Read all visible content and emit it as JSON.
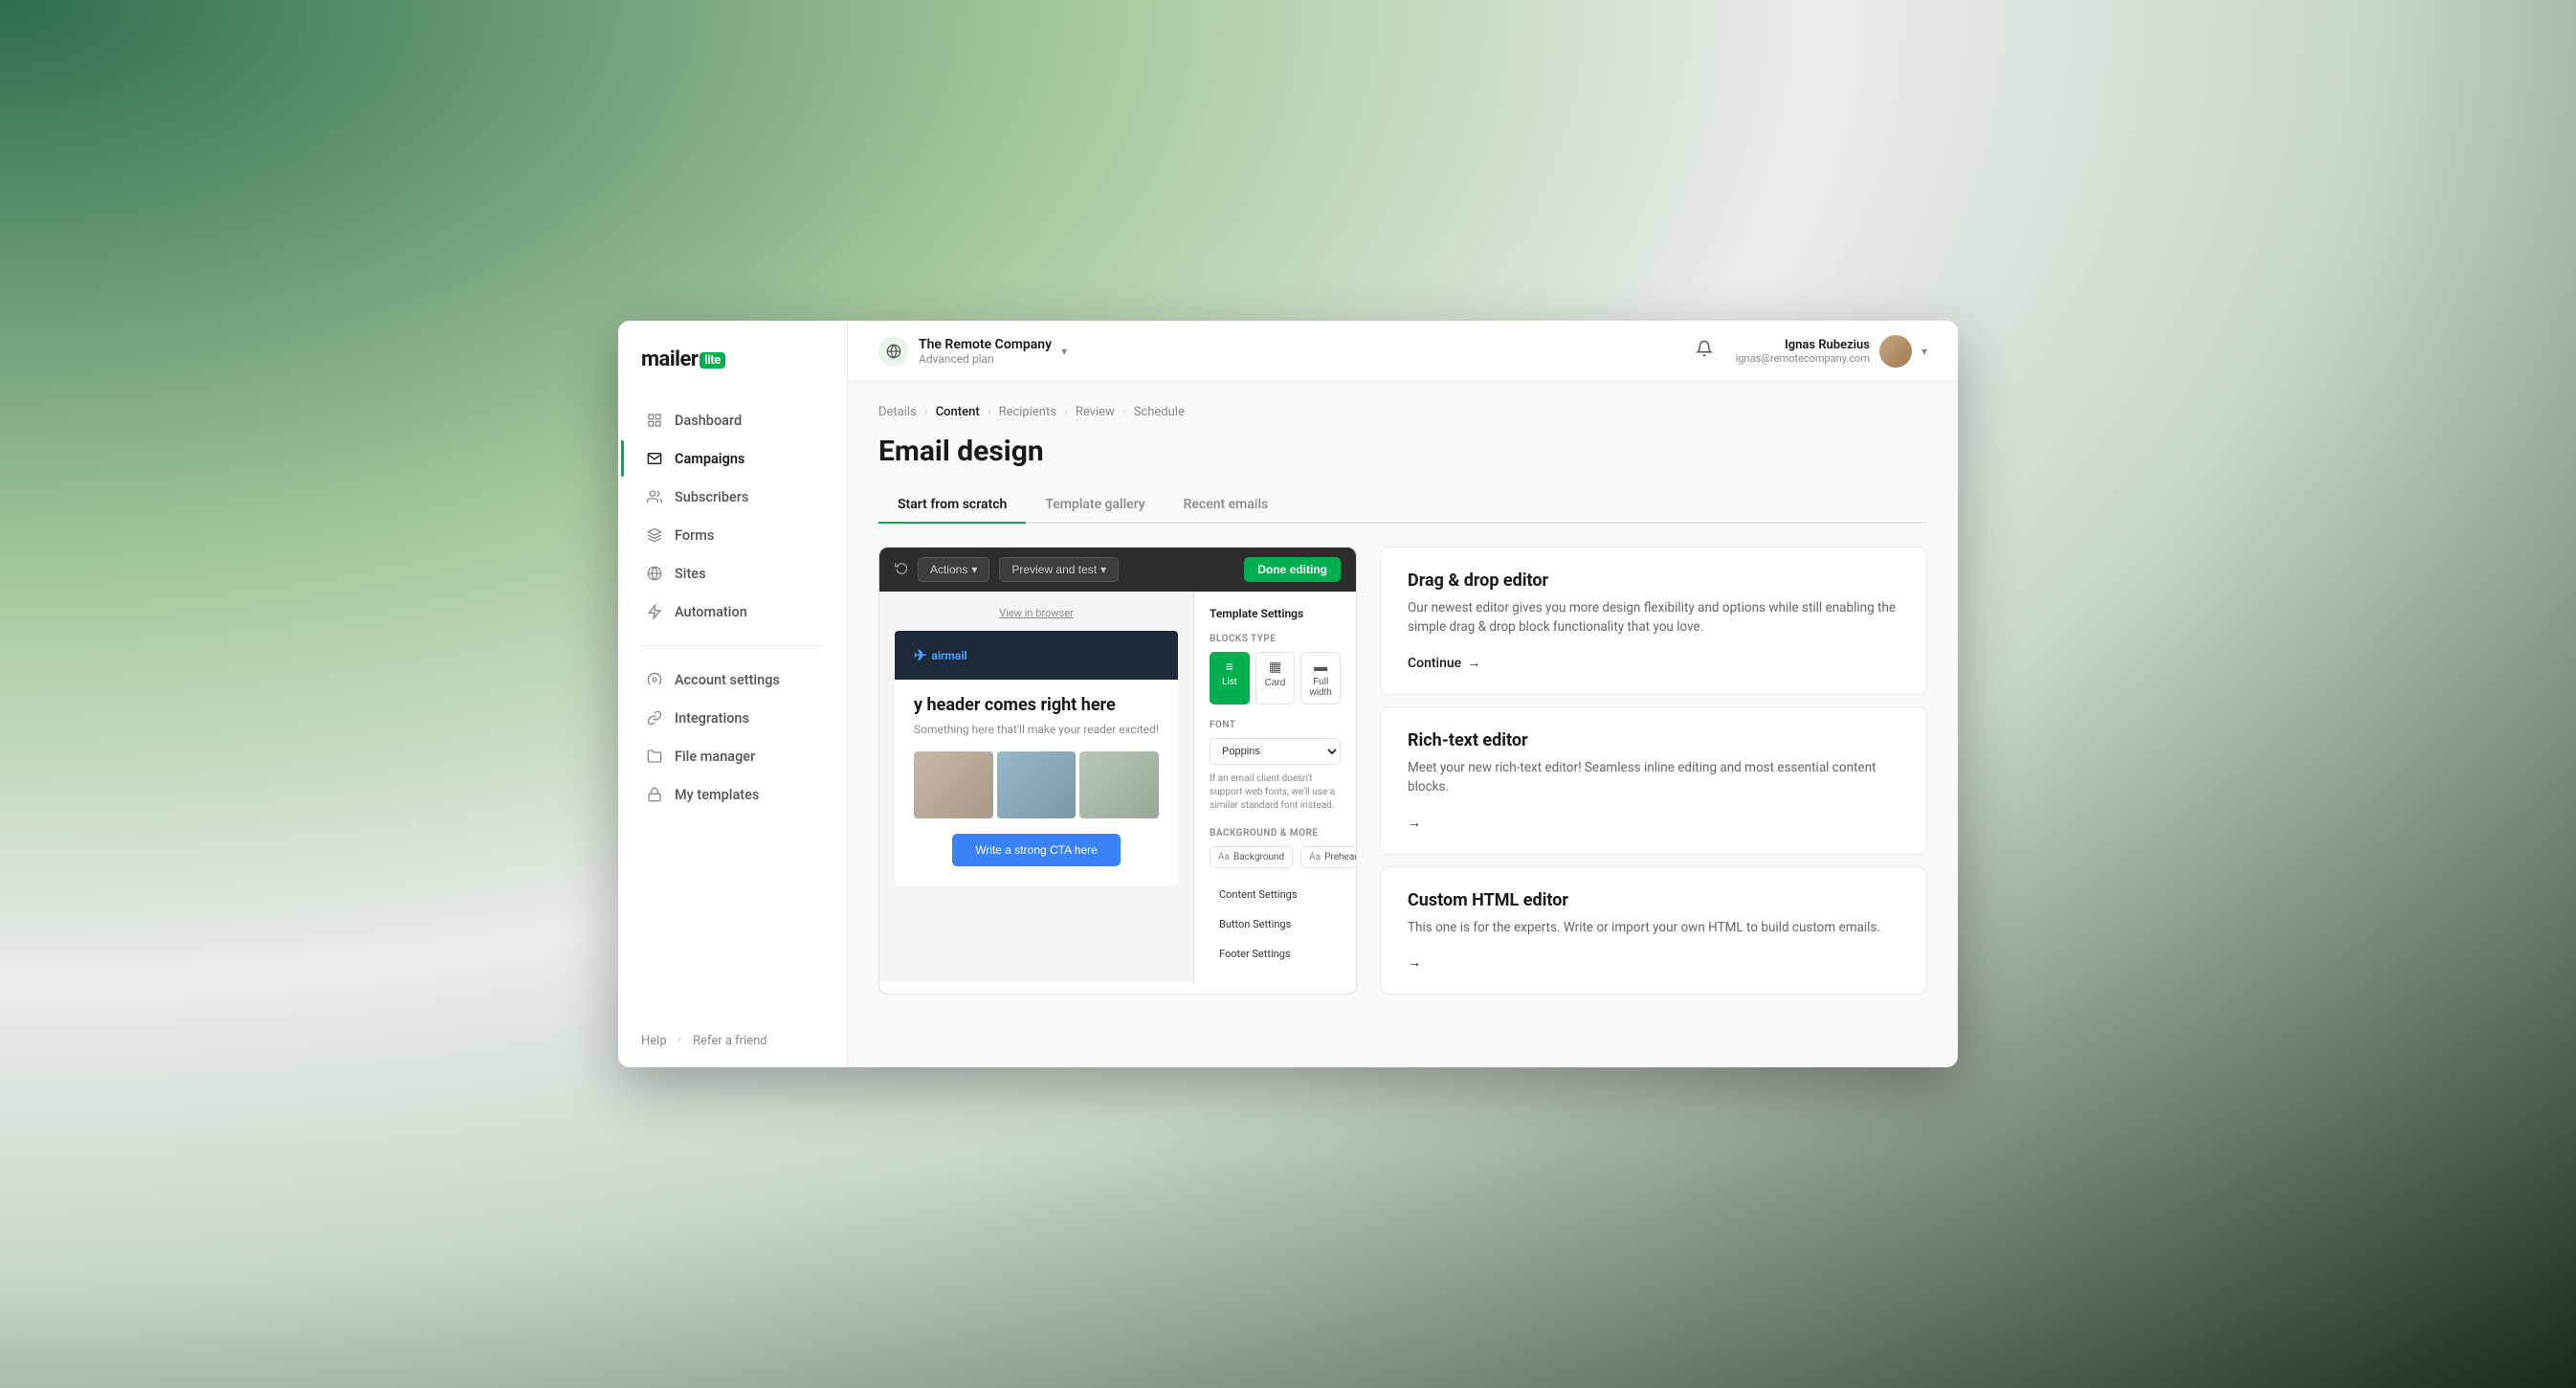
{
  "app": {
    "logo_main": "mailer",
    "logo_badge": "lite"
  },
  "header": {
    "company_name": "The Remote Company",
    "company_plan": "Advanced plan",
    "bell_icon": "bell",
    "user_name": "Ignas Rubezius",
    "user_email": "ignas@remotecompany.com",
    "chevron_icon": "chevron-down"
  },
  "sidebar": {
    "nav_items": [
      {
        "id": "dashboard",
        "label": "Dashboard",
        "icon": "grid"
      },
      {
        "id": "campaigns",
        "label": "Campaigns",
        "icon": "mail",
        "active": true
      },
      {
        "id": "subscribers",
        "label": "Subscribers",
        "icon": "users"
      },
      {
        "id": "forms",
        "label": "Forms",
        "icon": "layers"
      },
      {
        "id": "sites",
        "label": "Sites",
        "icon": "globe"
      },
      {
        "id": "automation",
        "label": "Automation",
        "icon": "zap"
      }
    ],
    "secondary_items": [
      {
        "id": "account-settings",
        "label": "Account settings",
        "icon": "settings"
      },
      {
        "id": "integrations",
        "label": "Integrations",
        "icon": "link"
      },
      {
        "id": "file-manager",
        "label": "File manager",
        "icon": "folder"
      },
      {
        "id": "my-templates",
        "label": "My templates",
        "icon": "lock"
      }
    ],
    "footer": {
      "help": "Help",
      "refer": "Refer a friend",
      "sep": "·"
    }
  },
  "breadcrumb": {
    "items": [
      "Details",
      "Content",
      "Recipients",
      "Review",
      "Schedule"
    ],
    "active": "Content"
  },
  "page": {
    "title": "Email design"
  },
  "tabs": [
    {
      "id": "scratch",
      "label": "Start from scratch",
      "active": true
    },
    {
      "id": "gallery",
      "label": "Template gallery",
      "active": false
    },
    {
      "id": "recent",
      "label": "Recent emails",
      "active": false
    }
  ],
  "editor_preview": {
    "toolbar": {
      "undo_icon": "undo",
      "actions_label": "Actions",
      "actions_chevron": "▾",
      "preview_label": "Preview and test",
      "preview_chevron": "▾",
      "done_label": "Done editing"
    },
    "email": {
      "view_in_browser": "View in browser",
      "brand": "airmail",
      "headline": "y header comes right here",
      "subtext": "Something here that'll make your reader excited!",
      "cta_label": "Write a strong CTA here"
    },
    "settings_panel": {
      "title": "Template Settings",
      "blocks_type_label": "BLOCKS TYPE",
      "blocks": [
        {
          "id": "list",
          "label": "List",
          "selected": true
        },
        {
          "id": "card",
          "label": "Card",
          "selected": false
        },
        {
          "id": "full-width",
          "label": "Full width",
          "selected": false
        }
      ],
      "font_label": "FONT",
      "font_value": "Poppins",
      "font_note": "If an email client doesn't support web fonts, we'll use a similar standard font instead.",
      "bg_label": "BACKGROUND & MORE",
      "bg_options": [
        {
          "id": "background",
          "label": "Background"
        },
        {
          "id": "preheader",
          "label": "Preheader"
        }
      ],
      "menu_items": [
        {
          "id": "content-settings",
          "label": "Content Settings"
        },
        {
          "id": "button-settings",
          "label": "Button Settings"
        },
        {
          "id": "footer-settings",
          "label": "Footer Settings"
        }
      ]
    }
  },
  "editor_options": [
    {
      "id": "drag-drop",
      "title": "Drag & drop editor",
      "description": "Our newest editor gives you more design flexibility and options while still enabling the simple drag & drop block functionality that you love.",
      "cta": "Continue",
      "cta_icon": "→"
    },
    {
      "id": "rich-text",
      "title": "Rich-text editor",
      "description": "Meet your new rich-text editor! Seamless inline editing and most essential content blocks.",
      "cta": "",
      "cta_icon": "→"
    },
    {
      "id": "custom-html",
      "title": "Custom HTML editor",
      "description": "This one is for the experts. Write or import your own HTML to build custom emails.",
      "cta": "",
      "cta_icon": "→"
    }
  ]
}
